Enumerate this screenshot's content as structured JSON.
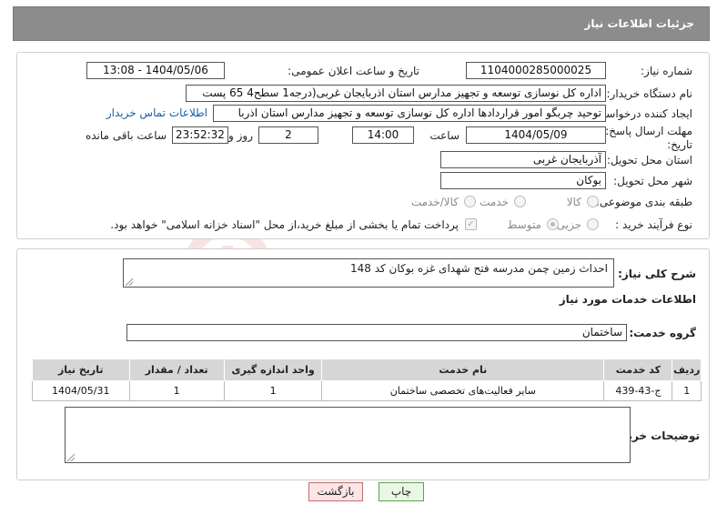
{
  "header": {
    "title": "جزئیات اطلاعات نیاز"
  },
  "fields": {
    "need_number_label": "شماره نیاز:",
    "need_number": "1104000285000025",
    "announce_label": "تاریخ و ساعت اعلان عمومی:",
    "announce_value": "1404/05/06 - 13:08",
    "buyer_org_label": "نام دستگاه خریدار:",
    "buyer_org": "اداره کل نوسازی   توسعه و تجهیز مدارس استان اذربایجان غربی(درجه1  سطح4  65 پست",
    "creator_label": "ایجاد کننده درخواست:",
    "creator": "توحید چربگو امور قراردادها اداره کل نوسازی   توسعه و تجهیز مدارس استان اذربا",
    "contact_link": "اطلاعات تماس خریدار",
    "deadline_label_1": "مهلت ارسال پاسخ: تا",
    "deadline_label_2": "تاریخ:",
    "deadline_date": "1404/05/09",
    "time_label": "ساعت",
    "deadline_time": "14:00",
    "days_value": "2",
    "days_label": "روز و",
    "remaining_time": "23:52:32",
    "remaining_label": "ساعت باقی مانده",
    "province_label": "استان محل تحویل:",
    "province": "آذربایجان غربی",
    "city_label": "شهر محل تحویل:",
    "city": "بوکان",
    "category_label": "طبقه بندی موضوعی:",
    "category_options": [
      "کالا",
      "خدمت",
      "کالا/خدمت"
    ],
    "process_label": "نوع فرآیند خرید :",
    "process_options": [
      "جزیی",
      "متوسط"
    ],
    "payment_note": "پرداخت تمام یا بخشی از مبلغ خرید،از محل \"اسناد خزانه اسلامی\" خواهد بود."
  },
  "summary": {
    "label": "شرح کلی نیاز:",
    "text": "احداث زمین چمن مدرسه فتح شهدای غزه بوکان کد 148"
  },
  "services": {
    "section_title": "اطلاعات خدمات مورد نیاز",
    "group_label": "گروه خدمت:",
    "group_value": "ساختمان",
    "columns": [
      "ردیف",
      "کد خدمت",
      "نام خدمت",
      "واحد اندازه گیری",
      "تعداد / مقدار",
      "تاریخ نیاز"
    ],
    "rows": [
      {
        "index": "1",
        "code": "ج-43-439",
        "name": "سایر فعالیت‌های تخصصی ساختمان",
        "unit": "1",
        "qty": "1",
        "date": "1404/05/31"
      }
    ]
  },
  "buyer_notes_label": "توضیحات خریدار:",
  "buttons": {
    "print": "چاپ",
    "back": "بازگشت"
  },
  "watermark_text": "AriaTender.neT"
}
